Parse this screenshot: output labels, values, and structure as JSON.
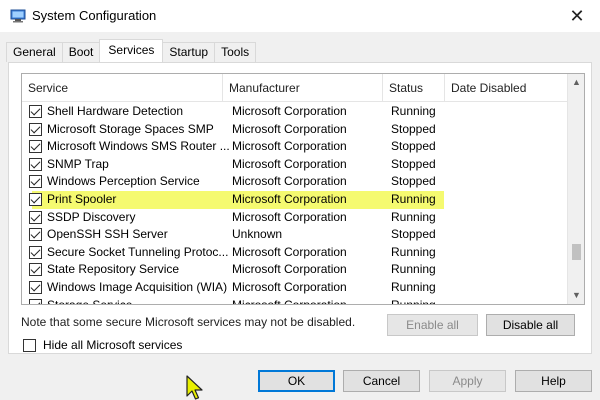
{
  "window": {
    "title": "System Configuration",
    "close_glyph": "✕"
  },
  "tabs": [
    {
      "label": "General"
    },
    {
      "label": "Boot"
    },
    {
      "label": "Services"
    },
    {
      "label": "Startup"
    },
    {
      "label": "Tools"
    }
  ],
  "active_tab": "Services",
  "columns": {
    "service": "Service",
    "manufacturer": "Manufacturer",
    "status": "Status",
    "date_disabled": "Date Disabled"
  },
  "services": [
    {
      "name": "Shell Hardware Detection",
      "manufacturer": "Microsoft Corporation",
      "status": "Running",
      "checked": true
    },
    {
      "name": "Microsoft Storage Spaces SMP",
      "manufacturer": "Microsoft Corporation",
      "status": "Stopped",
      "checked": true
    },
    {
      "name": "Microsoft Windows SMS Router ...",
      "manufacturer": "Microsoft Corporation",
      "status": "Stopped",
      "checked": true
    },
    {
      "name": "SNMP Trap",
      "manufacturer": "Microsoft Corporation",
      "status": "Stopped",
      "checked": true
    },
    {
      "name": "Windows Perception Service",
      "manufacturer": "Microsoft Corporation",
      "status": "Stopped",
      "checked": true
    },
    {
      "name": "Print Spooler",
      "manufacturer": "Microsoft Corporation",
      "status": "Running",
      "checked": true,
      "highlighted": true
    },
    {
      "name": "SSDP Discovery",
      "manufacturer": "Microsoft Corporation",
      "status": "Running",
      "checked": true
    },
    {
      "name": "OpenSSH SSH Server",
      "manufacturer": "Unknown",
      "status": "Stopped",
      "checked": true
    },
    {
      "name": "Secure Socket Tunneling Protoc...",
      "manufacturer": "Microsoft Corporation",
      "status": "Running",
      "checked": true
    },
    {
      "name": "State Repository Service",
      "manufacturer": "Microsoft Corporation",
      "status": "Running",
      "checked": true
    },
    {
      "name": "Windows Image Acquisition (WIA)",
      "manufacturer": "Microsoft Corporation",
      "status": "Running",
      "checked": true
    },
    {
      "name": "Storage Service",
      "manufacturer": "Microsoft Corporation",
      "status": "Running",
      "checked": true
    }
  ],
  "note": "Note that some secure Microsoft services may not be disabled.",
  "buttons": {
    "enable_all": "Enable all",
    "disable_all": "Disable all",
    "ok": "OK",
    "cancel": "Cancel",
    "apply": "Apply",
    "help": "Help"
  },
  "hide_ms_label": "Hide all Microsoft services",
  "colors": {
    "highlight": "#f5fa70",
    "default_button_border": "#0078d7"
  }
}
